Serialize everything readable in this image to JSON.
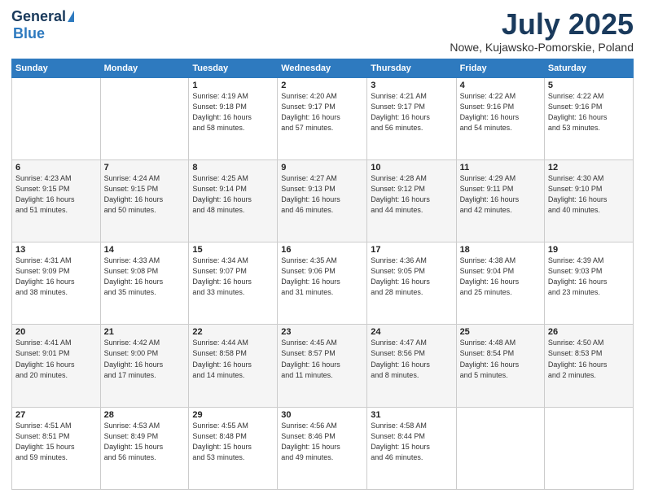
{
  "header": {
    "logo_general": "General",
    "logo_blue": "Blue",
    "title": "July 2025",
    "location": "Nowe, Kujawsko-Pomorskie, Poland"
  },
  "calendar": {
    "days_of_week": [
      "Sunday",
      "Monday",
      "Tuesday",
      "Wednesday",
      "Thursday",
      "Friday",
      "Saturday"
    ],
    "weeks": [
      [
        {
          "day": "",
          "info": ""
        },
        {
          "day": "",
          "info": ""
        },
        {
          "day": "1",
          "info": "Sunrise: 4:19 AM\nSunset: 9:18 PM\nDaylight: 16 hours\nand 58 minutes."
        },
        {
          "day": "2",
          "info": "Sunrise: 4:20 AM\nSunset: 9:17 PM\nDaylight: 16 hours\nand 57 minutes."
        },
        {
          "day": "3",
          "info": "Sunrise: 4:21 AM\nSunset: 9:17 PM\nDaylight: 16 hours\nand 56 minutes."
        },
        {
          "day": "4",
          "info": "Sunrise: 4:22 AM\nSunset: 9:16 PM\nDaylight: 16 hours\nand 54 minutes."
        },
        {
          "day": "5",
          "info": "Sunrise: 4:22 AM\nSunset: 9:16 PM\nDaylight: 16 hours\nand 53 minutes."
        }
      ],
      [
        {
          "day": "6",
          "info": "Sunrise: 4:23 AM\nSunset: 9:15 PM\nDaylight: 16 hours\nand 51 minutes."
        },
        {
          "day": "7",
          "info": "Sunrise: 4:24 AM\nSunset: 9:15 PM\nDaylight: 16 hours\nand 50 minutes."
        },
        {
          "day": "8",
          "info": "Sunrise: 4:25 AM\nSunset: 9:14 PM\nDaylight: 16 hours\nand 48 minutes."
        },
        {
          "day": "9",
          "info": "Sunrise: 4:27 AM\nSunset: 9:13 PM\nDaylight: 16 hours\nand 46 minutes."
        },
        {
          "day": "10",
          "info": "Sunrise: 4:28 AM\nSunset: 9:12 PM\nDaylight: 16 hours\nand 44 minutes."
        },
        {
          "day": "11",
          "info": "Sunrise: 4:29 AM\nSunset: 9:11 PM\nDaylight: 16 hours\nand 42 minutes."
        },
        {
          "day": "12",
          "info": "Sunrise: 4:30 AM\nSunset: 9:10 PM\nDaylight: 16 hours\nand 40 minutes."
        }
      ],
      [
        {
          "day": "13",
          "info": "Sunrise: 4:31 AM\nSunset: 9:09 PM\nDaylight: 16 hours\nand 38 minutes."
        },
        {
          "day": "14",
          "info": "Sunrise: 4:33 AM\nSunset: 9:08 PM\nDaylight: 16 hours\nand 35 minutes."
        },
        {
          "day": "15",
          "info": "Sunrise: 4:34 AM\nSunset: 9:07 PM\nDaylight: 16 hours\nand 33 minutes."
        },
        {
          "day": "16",
          "info": "Sunrise: 4:35 AM\nSunset: 9:06 PM\nDaylight: 16 hours\nand 31 minutes."
        },
        {
          "day": "17",
          "info": "Sunrise: 4:36 AM\nSunset: 9:05 PM\nDaylight: 16 hours\nand 28 minutes."
        },
        {
          "day": "18",
          "info": "Sunrise: 4:38 AM\nSunset: 9:04 PM\nDaylight: 16 hours\nand 25 minutes."
        },
        {
          "day": "19",
          "info": "Sunrise: 4:39 AM\nSunset: 9:03 PM\nDaylight: 16 hours\nand 23 minutes."
        }
      ],
      [
        {
          "day": "20",
          "info": "Sunrise: 4:41 AM\nSunset: 9:01 PM\nDaylight: 16 hours\nand 20 minutes."
        },
        {
          "day": "21",
          "info": "Sunrise: 4:42 AM\nSunset: 9:00 PM\nDaylight: 16 hours\nand 17 minutes."
        },
        {
          "day": "22",
          "info": "Sunrise: 4:44 AM\nSunset: 8:58 PM\nDaylight: 16 hours\nand 14 minutes."
        },
        {
          "day": "23",
          "info": "Sunrise: 4:45 AM\nSunset: 8:57 PM\nDaylight: 16 hours\nand 11 minutes."
        },
        {
          "day": "24",
          "info": "Sunrise: 4:47 AM\nSunset: 8:56 PM\nDaylight: 16 hours\nand 8 minutes."
        },
        {
          "day": "25",
          "info": "Sunrise: 4:48 AM\nSunset: 8:54 PM\nDaylight: 16 hours\nand 5 minutes."
        },
        {
          "day": "26",
          "info": "Sunrise: 4:50 AM\nSunset: 8:53 PM\nDaylight: 16 hours\nand 2 minutes."
        }
      ],
      [
        {
          "day": "27",
          "info": "Sunrise: 4:51 AM\nSunset: 8:51 PM\nDaylight: 15 hours\nand 59 minutes."
        },
        {
          "day": "28",
          "info": "Sunrise: 4:53 AM\nSunset: 8:49 PM\nDaylight: 15 hours\nand 56 minutes."
        },
        {
          "day": "29",
          "info": "Sunrise: 4:55 AM\nSunset: 8:48 PM\nDaylight: 15 hours\nand 53 minutes."
        },
        {
          "day": "30",
          "info": "Sunrise: 4:56 AM\nSunset: 8:46 PM\nDaylight: 15 hours\nand 49 minutes."
        },
        {
          "day": "31",
          "info": "Sunrise: 4:58 AM\nSunset: 8:44 PM\nDaylight: 15 hours\nand 46 minutes."
        },
        {
          "day": "",
          "info": ""
        },
        {
          "day": "",
          "info": ""
        }
      ]
    ]
  }
}
